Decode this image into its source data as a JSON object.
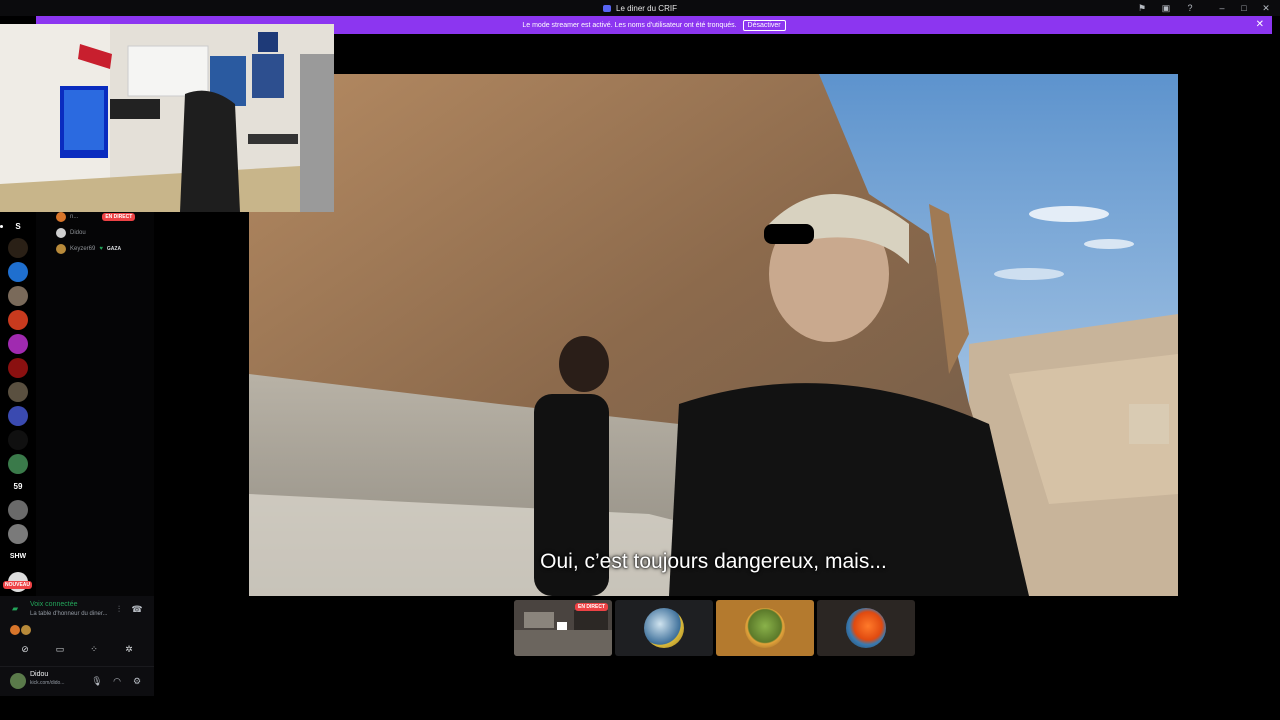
{
  "window": {
    "title": "Le diner du CRIF",
    "icons": [
      "pin-icon",
      "inbox-icon",
      "help-icon"
    ],
    "controls": [
      "minimize-icon",
      "maximize-icon",
      "close-icon"
    ]
  },
  "banner": {
    "message": "Le mode streamer est activé. Les noms d'utilisateur ont été tronqués.",
    "button_label": "Désactiver"
  },
  "server_rail": {
    "top_label": "S",
    "labels": [
      "59",
      "SHW"
    ],
    "new_badge": "NOUVEAU"
  },
  "channel_members": [
    {
      "name": "n...",
      "badge": "EN DIRECT"
    },
    {
      "name": "Didou"
    },
    {
      "name": "Keyzer69",
      "tag": "GAZA"
    }
  ],
  "voice": {
    "status": "Voix connectée",
    "channel": "La table d'honneur du diner..."
  },
  "user": {
    "name": "Didou",
    "status": "kick.com/dido..."
  },
  "stream": {
    "subtitle": "Oui, c’est toujours dangereux, mais..."
  },
  "tiles": [
    {
      "live_label": "EN DIRECT"
    }
  ],
  "colors": {
    "banner": "#8c36f0",
    "live": "#ed4245",
    "voice_green": "#23a55a"
  }
}
